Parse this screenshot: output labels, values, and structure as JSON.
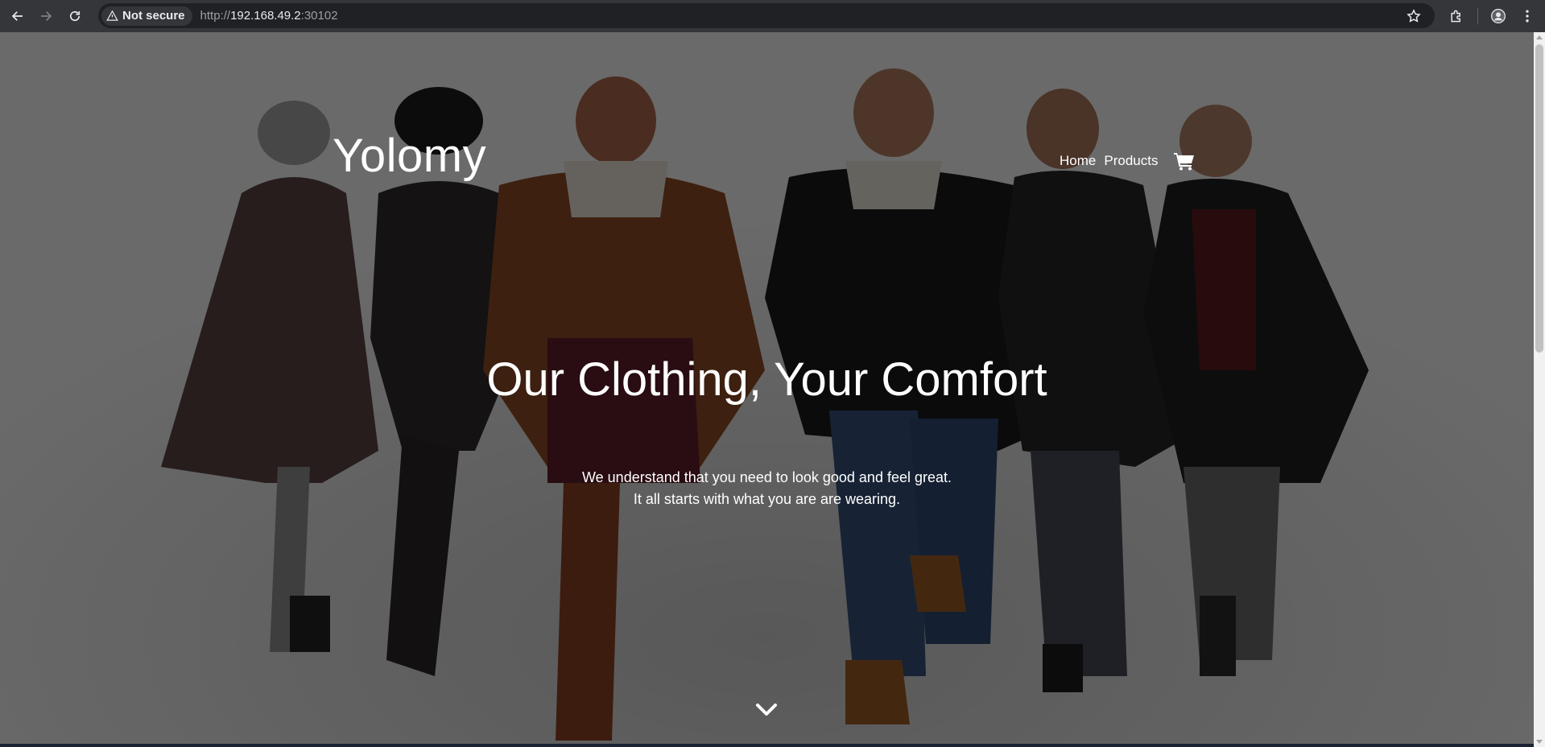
{
  "browser": {
    "security_label": "Not secure",
    "url_scheme": "http://",
    "url_host": "192.168.49.2",
    "url_port": ":30102",
    "icons": [
      "back-icon",
      "forward-icon",
      "reload-icon",
      "warning-icon",
      "star-icon",
      "extensions-icon",
      "profile-icon",
      "menu-icon"
    ]
  },
  "site": {
    "brand": "Yolomy",
    "nav": [
      {
        "label": "Home"
      },
      {
        "label": "Products"
      }
    ],
    "cart_icon": "cart-icon"
  },
  "hero": {
    "headline": "Our Clothing, Your Comfort",
    "sub_line1": "We understand that you need to look good and feel great.",
    "sub_line2": "It all starts with what you are are wearing.",
    "scroll_icon": "chevron-down-icon",
    "overlay_color": "#000000"
  }
}
